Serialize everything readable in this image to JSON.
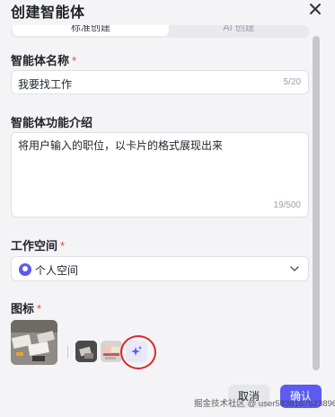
{
  "dialog": {
    "title": "创建智能体",
    "tabs": [
      {
        "label": "标准创建",
        "active": true
      },
      {
        "label": "AI 创建",
        "active": false
      }
    ]
  },
  "form": {
    "name": {
      "label": "智能体名称",
      "required_mark": "*",
      "value": "我要找工作",
      "count": "5/20"
    },
    "description": {
      "label": "智能体功能介绍",
      "value": "将用户输入的职位，以卡片的格式展现出来",
      "count": "19/500"
    },
    "workspace": {
      "label": "工作空间",
      "required_mark": "*",
      "value": "个人空间"
    },
    "icon": {
      "label": "图标",
      "required_mark": "*"
    }
  },
  "footer": {
    "cancel_label": "取消",
    "confirm_label": "确认"
  },
  "watermark": "掘金技术社区 @ user5838167523896",
  "colors": {
    "accent": "#5c5cf3",
    "required": "#f04438",
    "highlight_ring": "#d6262c"
  },
  "icons": [
    "close-icon",
    "chevron-down-icon",
    "user-avatar-icon",
    "ai-sparkle-icon"
  ]
}
